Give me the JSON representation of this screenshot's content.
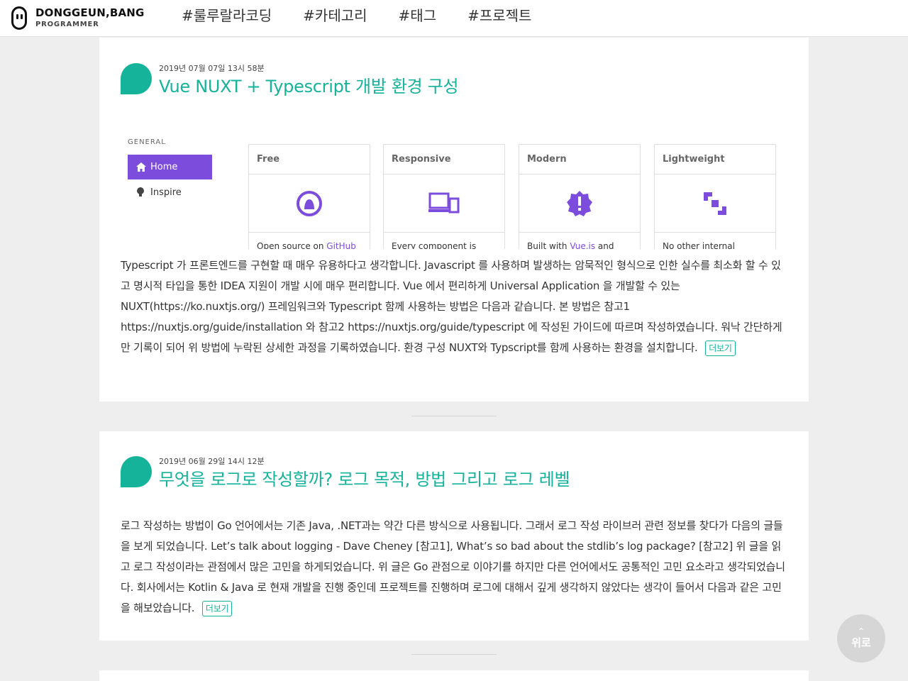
{
  "header": {
    "logo_name": "DONGGEUN,BANG",
    "logo_role": "PROGRAMMER",
    "nav": [
      "#룰루랄라코딩",
      "#카테고리",
      "#태그",
      "#프로젝트"
    ]
  },
  "posts": [
    {
      "date": "2019년 07월 07일 13시 58분",
      "title": "Vue NUXT + Typescript 개발 환경 구성",
      "excerpt": "Typescript 가 프론트엔드를 구현할 때 매우 유용하다고 생각합니다. Javascript 를 사용하며 발생하는 암묵적인 형식으로 인한 실수를 최소화 할 수 있고 명시적 타입을 통한 IDEA 지원이 개발 시에 매우 편리합니다. Vue 에서 편리하게 Universal Application 을 개발할 수 있는 NUXT(https://ko.nuxtjs.org/) 프레임워크와 Typescript 함께 사용하는 방법은 다음과 같습니다. 본 방법은 참고1 https://nuxtjs.org/guide/installation 와 참고2 https://nuxtjs.org/guide/typescript 에 작성된 가이드에 따르며 작성하였습니다. 워낙 간단하게만 기록이 되어 위 방법에 누락된 상세한 과정을 기록하였습니다. 환경 구성 NUXT와 Typscript를 함께 사용하는 환경을 설치합니다.",
      "more": "더보기",
      "thumbnail": {
        "section": "GENERAL",
        "home": "Home",
        "inspire": "Inspire",
        "cards": [
          {
            "title": "Free",
            "text": "Open source on ",
            "link": "GitHub",
            "tail": ""
          },
          {
            "title": "Responsive",
            "text": "Every component is",
            "link": "",
            "tail": ""
          },
          {
            "title": "Modern",
            "text": "Built with ",
            "link": "Vue.js",
            "tail": " and"
          },
          {
            "title": "Lightweight",
            "text": "No other internal",
            "link": "",
            "tail": ""
          }
        ]
      }
    },
    {
      "date": "2019년 06월 29일 14시 12분",
      "title": "무엇을 로그로 작성할까? 로그 목적, 방법 그리고 로그 레벨",
      "excerpt": "로그 작성하는 방법이 Go 언어에서는 기존 Java, .NET과는 약간 다른 방식으로 사용됩니다. 그래서 로그 작성 라이브러 관련 정보를 찾다가 다음의 글들을 보게 되었습니다. Let’s talk about logging - Dave Cheney [참고1], What’s so bad about the stdlib’s log package? [참고2] 위 글을 읽고 로그 작성이라는 관점에서 많은 고민을 하게되었습니다. 위 글은 Go 관점으로 이야기를 하지만 다른 언어에서도 공통적인 고민 요소라고 생각되었습니다. 회사에서는 Kotlin & Java 로 현재 개발을 진행 중인데 프로젝트를 진행하며 로그에 대해서 깊게 생각하지 않았다는 생각이 들어서 다음과 같은 고민을 해보았습니다.",
      "more": "더보기"
    }
  ],
  "top_button": {
    "arrow": "⌃",
    "label": "위로"
  },
  "colors": {
    "accent": "#14b39a",
    "purple": "#7c4ddd",
    "background": "#eeeeee"
  }
}
